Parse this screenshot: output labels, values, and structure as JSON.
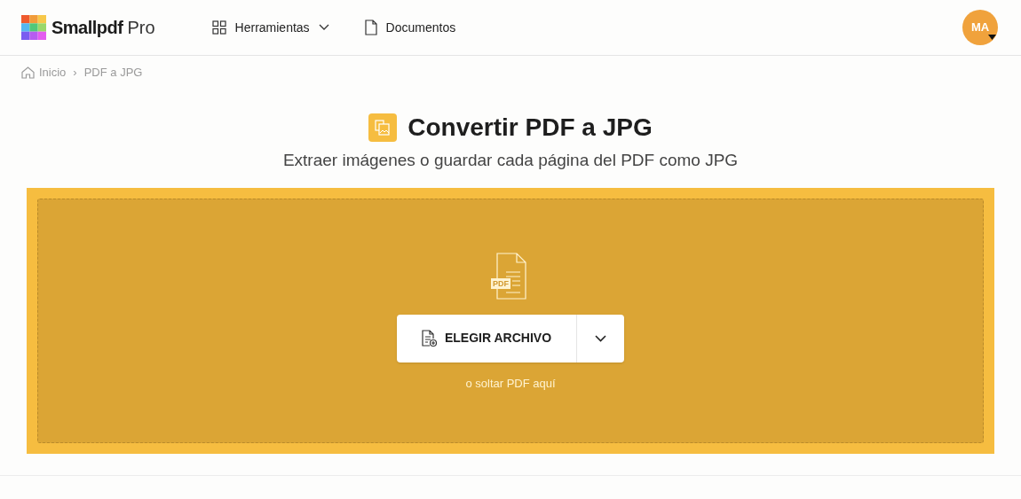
{
  "header": {
    "brand": "Smallpdf",
    "plan": "Pro",
    "nav": [
      {
        "kind": "grid",
        "label": "Herramientas",
        "dropdown": true
      },
      {
        "kind": "doc",
        "label": "Documentos",
        "dropdown": false
      }
    ],
    "avatar": "MA"
  },
  "breadcrumb": [
    {
      "label": "Inicio",
      "kind": "home"
    },
    {
      "label": "PDF a JPG",
      "kind": "page"
    }
  ],
  "breadcrumb_separator": "›",
  "title": "Convertir PDF a JPG",
  "subtitle": "Extraer imágenes o guardar cada página del PDF como JPG",
  "dropzone": {
    "file_badge": "PDF",
    "button": "ELEGIR ARCHIVO",
    "hint": "o soltar PDF aquí"
  }
}
